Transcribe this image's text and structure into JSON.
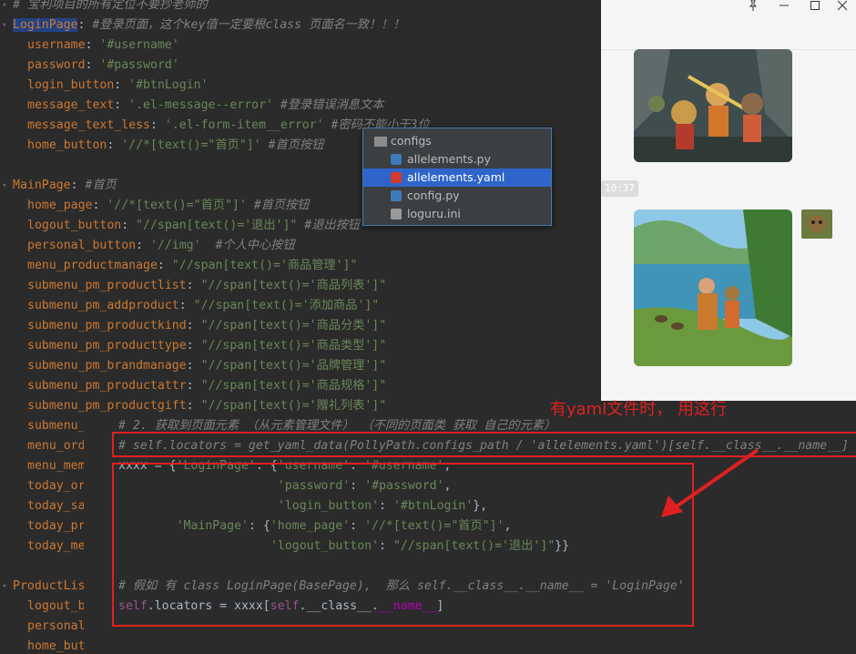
{
  "editor": {
    "lines": [
      {
        "indent": 0,
        "parts": [
          [
            "c",
            "# 宝利项目的所有定位不要抄老师的"
          ]
        ]
      },
      {
        "indent": 0,
        "parts": [
          [
            "k-sel",
            "LoginPage"
          ],
          [
            "n",
            ": "
          ],
          [
            "c",
            "#登录页面，这个key值一定要根class 页面名一致！！！"
          ]
        ]
      },
      {
        "indent": 1,
        "parts": [
          [
            "k",
            "username"
          ],
          [
            "n",
            ": "
          ],
          [
            "s",
            "'#username'"
          ]
        ]
      },
      {
        "indent": 1,
        "parts": [
          [
            "k",
            "password"
          ],
          [
            "n",
            ": "
          ],
          [
            "s",
            "'#password'"
          ]
        ]
      },
      {
        "indent": 1,
        "parts": [
          [
            "k",
            "login_button"
          ],
          [
            "n",
            ": "
          ],
          [
            "s",
            "'#btnLogin'"
          ]
        ]
      },
      {
        "indent": 1,
        "parts": [
          [
            "k",
            "message_text"
          ],
          [
            "n",
            ": "
          ],
          [
            "s",
            "'.el-message--error'"
          ],
          [
            "c",
            " #登录错误消息文本"
          ]
        ]
      },
      {
        "indent": 1,
        "parts": [
          [
            "k",
            "message_text_less"
          ],
          [
            "n",
            ": "
          ],
          [
            "s",
            "'.el-form-item__error'"
          ],
          [
            "c",
            " #密码不能小于3位"
          ]
        ]
      },
      {
        "indent": 1,
        "parts": [
          [
            "k",
            "home_button"
          ],
          [
            "n",
            ": "
          ],
          [
            "s",
            "'//*[text()=\"首页\"]'"
          ],
          [
            "c",
            " #首页按钮"
          ]
        ]
      },
      {
        "indent": 0,
        "parts": []
      },
      {
        "indent": 0,
        "parts": [
          [
            "k",
            "MainPage"
          ],
          [
            "n",
            ": "
          ],
          [
            "c",
            "#首页"
          ]
        ]
      },
      {
        "indent": 1,
        "parts": [
          [
            "k",
            "home_page"
          ],
          [
            "n",
            ": "
          ],
          [
            "s",
            "'//*[text()=\"首页\"]'"
          ],
          [
            "c",
            " #首页按钮"
          ]
        ]
      },
      {
        "indent": 1,
        "parts": [
          [
            "k",
            "logout_button"
          ],
          [
            "n",
            ": "
          ],
          [
            "s",
            "\"//span[text()='退出']\""
          ],
          [
            "c",
            " #退出按钮"
          ]
        ]
      },
      {
        "indent": 1,
        "parts": [
          [
            "k",
            "personal_button"
          ],
          [
            "n",
            ": "
          ],
          [
            "s",
            "'//img'"
          ],
          [
            "c",
            "  #个人中心按钮"
          ]
        ]
      },
      {
        "indent": 1,
        "parts": [
          [
            "k",
            "menu_productmanage"
          ],
          [
            "n",
            ": "
          ],
          [
            "s",
            "\"//span[text()='商品管理']\""
          ]
        ]
      },
      {
        "indent": 1,
        "parts": [
          [
            "k",
            "submenu_pm_productlist"
          ],
          [
            "n",
            ": "
          ],
          [
            "s",
            "\"//span[text()='商品列表']\""
          ]
        ]
      },
      {
        "indent": 1,
        "parts": [
          [
            "k",
            "submenu_pm_addproduct"
          ],
          [
            "n",
            ": "
          ],
          [
            "s",
            "\"//span[text()='添加商品']\""
          ]
        ]
      },
      {
        "indent": 1,
        "parts": [
          [
            "k",
            "submenu_pm_productkind"
          ],
          [
            "n",
            ": "
          ],
          [
            "s",
            "\"//span[text()='商品分类']\""
          ]
        ]
      },
      {
        "indent": 1,
        "parts": [
          [
            "k",
            "submenu_pm_producttype"
          ],
          [
            "n",
            ": "
          ],
          [
            "s",
            "\"//span[text()='商品类型']\""
          ]
        ]
      },
      {
        "indent": 1,
        "parts": [
          [
            "k",
            "submenu_pm_brandmanage"
          ],
          [
            "n",
            ": "
          ],
          [
            "s",
            "\"//span[text()='品牌管理']\""
          ]
        ]
      },
      {
        "indent": 1,
        "parts": [
          [
            "k",
            "submenu_pm_productattr"
          ],
          [
            "n",
            ": "
          ],
          [
            "s",
            "\"//span[text()='商品规格']\""
          ]
        ]
      },
      {
        "indent": 1,
        "parts": [
          [
            "k",
            "submenu_pm_productgift"
          ],
          [
            "n",
            ": "
          ],
          [
            "s",
            "\"//span[text()='赠礼列表']\""
          ]
        ]
      },
      {
        "indent": 1,
        "parts": [
          [
            "k",
            "submenu_"
          ]
        ]
      },
      {
        "indent": 1,
        "parts": [
          [
            "k",
            "menu_ord"
          ]
        ]
      },
      {
        "indent": 1,
        "parts": [
          [
            "k",
            "menu_mem"
          ]
        ]
      },
      {
        "indent": 1,
        "parts": [
          [
            "k",
            "today_or"
          ]
        ]
      },
      {
        "indent": 1,
        "parts": [
          [
            "k",
            "today_sa"
          ]
        ]
      },
      {
        "indent": 1,
        "parts": [
          [
            "k",
            "today_pr"
          ]
        ]
      },
      {
        "indent": 1,
        "parts": [
          [
            "k",
            "today_me"
          ]
        ]
      },
      {
        "indent": 0,
        "parts": []
      },
      {
        "indent": 0,
        "parts": [
          [
            "k",
            "ProductLis"
          ]
        ]
      },
      {
        "indent": 1,
        "parts": [
          [
            "k",
            "logout_b"
          ]
        ]
      },
      {
        "indent": 1,
        "parts": [
          [
            "k",
            "personal"
          ]
        ]
      },
      {
        "indent": 1,
        "parts": [
          [
            "k",
            "home_but"
          ]
        ]
      }
    ]
  },
  "file_tree": {
    "folder": "configs",
    "files": [
      {
        "name": "allelements.py",
        "type": "py",
        "selected": false
      },
      {
        "name": "allelements.yaml",
        "type": "yaml",
        "selected": true
      },
      {
        "name": "config.py",
        "type": "py",
        "selected": false
      },
      {
        "name": "loguru.ini",
        "type": "ini",
        "selected": false
      }
    ]
  },
  "chat": {
    "timestamp": "10:37",
    "window_controls": [
      "pin-icon",
      "minimize-icon",
      "maximize-icon",
      "close-icon"
    ]
  },
  "overlay": {
    "lines": [
      {
        "col": 0,
        "parts": [
          [
            "c",
            "# 2. 获取到页面元素 （从元素管理文件） （不同的页面类 获取 自己的元素）"
          ]
        ]
      },
      {
        "col": 0,
        "parts": [
          [
            "c",
            "# self.locators = get_yaml_data(PollyPath.configs_path / 'allelements.yaml')[self.__class__.__name__]"
          ]
        ]
      },
      {
        "col": 0,
        "parts": [
          [
            "n",
            "xxxx = {"
          ],
          [
            "s",
            "'LoginPage'"
          ],
          [
            "n",
            ": {"
          ],
          [
            "s",
            "'username'"
          ],
          [
            "n",
            ": "
          ],
          [
            "s",
            "'#username'"
          ],
          [
            "n",
            ","
          ]
        ]
      },
      {
        "col": 22,
        "parts": [
          [
            "s",
            "'password'"
          ],
          [
            "n",
            ": "
          ],
          [
            "s",
            "'#password'"
          ],
          [
            "n",
            ","
          ]
        ]
      },
      {
        "col": 22,
        "parts": [
          [
            "s",
            "'login_button'"
          ],
          [
            "n",
            ": "
          ],
          [
            "s",
            "'#btnLogin'"
          ],
          [
            "n",
            "},"
          ]
        ]
      },
      {
        "col": 8,
        "parts": [
          [
            "s",
            "'MainPage'"
          ],
          [
            "n",
            ": {"
          ],
          [
            "s",
            "'home_page'"
          ],
          [
            "n",
            ": "
          ],
          [
            "s",
            "'//*[text()=\"首页\"]'"
          ],
          [
            "n",
            ","
          ]
        ]
      },
      {
        "col": 21,
        "parts": [
          [
            "s",
            "'logout_button'"
          ],
          [
            "n",
            ": "
          ],
          [
            "s",
            "\"//span[text()='退出']\""
          ],
          [
            "n",
            "}}"
          ]
        ]
      },
      {
        "col": 0,
        "parts": []
      },
      {
        "col": 0,
        "parts": [
          [
            "c",
            "# 假如 有 class LoginPage(BasePage),  那么 self.__class__.__name__ = 'LoginPage'"
          ]
        ]
      },
      {
        "col": 0,
        "parts": [
          [
            "self",
            "self"
          ],
          [
            "n",
            ".locators = xxxx["
          ],
          [
            "self",
            "self"
          ],
          [
            "n",
            ".__class__."
          ],
          [
            "dunder",
            "__name__"
          ],
          [
            "n",
            "]"
          ]
        ]
      }
    ]
  },
  "annotation": {
    "text": "有yaml文件时， 用这行"
  },
  "colors": {
    "annotation": "#e02020",
    "selection": "#2f65ca"
  }
}
